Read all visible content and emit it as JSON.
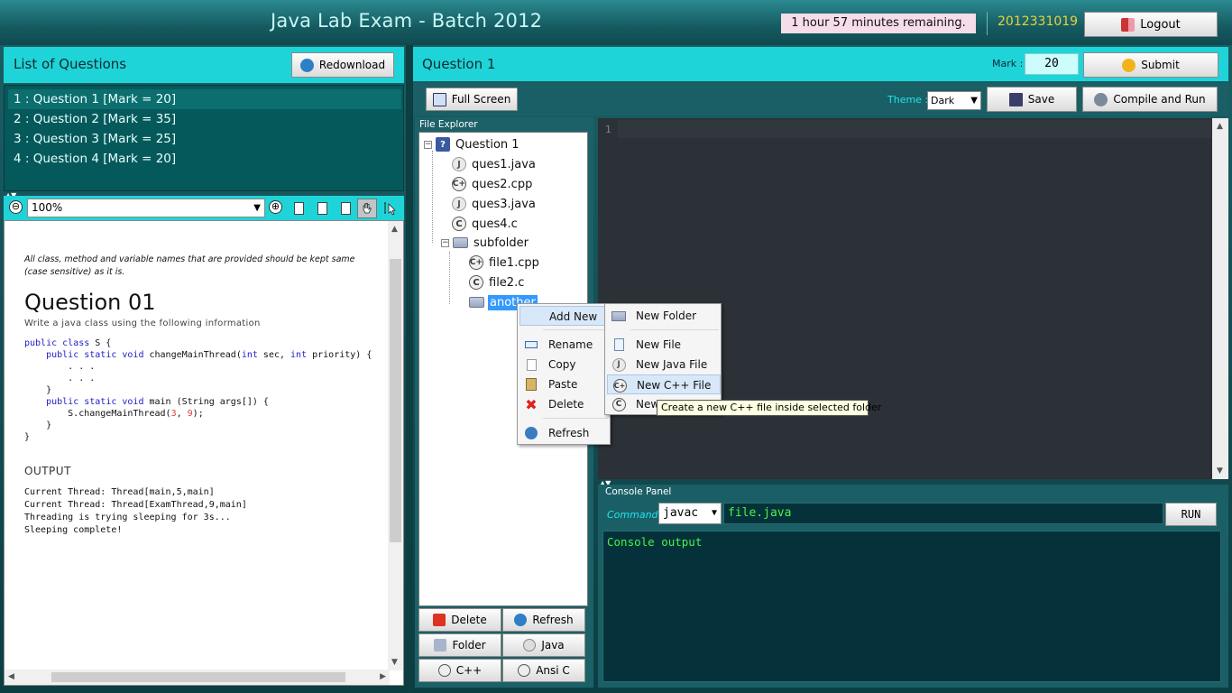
{
  "header": {
    "title": "Java Lab Exam - Batch 2012",
    "timer": "1 hour 57 minutes remaining.",
    "student_id": "2012331019",
    "logout_label": "Logout"
  },
  "questions_panel": {
    "title": "List of Questions",
    "redownload_label": "Redownload",
    "items": [
      "1 : Question 1 [Mark = 20]",
      "2 : Question 2 [Mark = 35]",
      "3 : Question 3 [Mark = 25]",
      "4 : Question 4 [Mark = 20]"
    ]
  },
  "pdf_toolbar": {
    "zoom": "100%",
    "zoom_minus": "⊖",
    "zoom_plus": "⊕"
  },
  "pdf": {
    "note": "All class, method and variable names that are provided should be kept same (case sensitive) as it is.",
    "question_title": "Question 01",
    "description": "Write a java class using the following information",
    "output_heading": "OUTPUT",
    "output_lines": "Current Thread: Thread[main,5,main]\nCurrent Thread: Thread[ExamThread,9,main]\nThreading is trying sleeping for 3s...\nSleeping complete!"
  },
  "editor_panel": {
    "title": "Question 1",
    "mark_label": "Mark :",
    "mark_value": "20",
    "submit_label": "Submit",
    "fullscreen_label": "Full Screen",
    "theme_label": "Theme :",
    "theme_value": "Dark",
    "save_label": "Save",
    "compile_label": "Compile and Run",
    "line_number": "1"
  },
  "file_explorer": {
    "legend": "File Explorer",
    "root": "Question 1",
    "files": [
      "ques1.java",
      "ques2.cpp",
      "ques3.java",
      "ques4.c"
    ],
    "subfolder": "subfolder",
    "sub_files": [
      "file1.cpp",
      "file2.c"
    ],
    "selected_folder": "another",
    "buttons": {
      "delete": "Delete",
      "refresh": "Refresh",
      "folder": "Folder",
      "java": "Java",
      "cpp": "C++",
      "ansi_c": "Ansi C"
    }
  },
  "context_menu": {
    "add_new": "Add New",
    "rename": "Rename",
    "copy": "Copy",
    "paste": "Paste",
    "delete": "Delete",
    "refresh": "Refresh"
  },
  "submenu": {
    "new_folder": "New Folder",
    "new_file": "New File",
    "new_java": "New Java File",
    "new_cpp": "New C++ File",
    "new_c": "New"
  },
  "tooltip": "Create a new C++ file inside selected folder",
  "console": {
    "legend": "Console Panel",
    "command_label": "Command :",
    "command_value": "javac",
    "input_value": "file.java",
    "run_label": "RUN",
    "output": "Console output"
  },
  "colors": {
    "header_bg": "#155a60",
    "panel_cyan": "#1fd4d8",
    "list_bg": "#05595a",
    "editor_bg": "#2b3136",
    "console_text": "#49f24b",
    "id_text": "#e8d23a"
  }
}
